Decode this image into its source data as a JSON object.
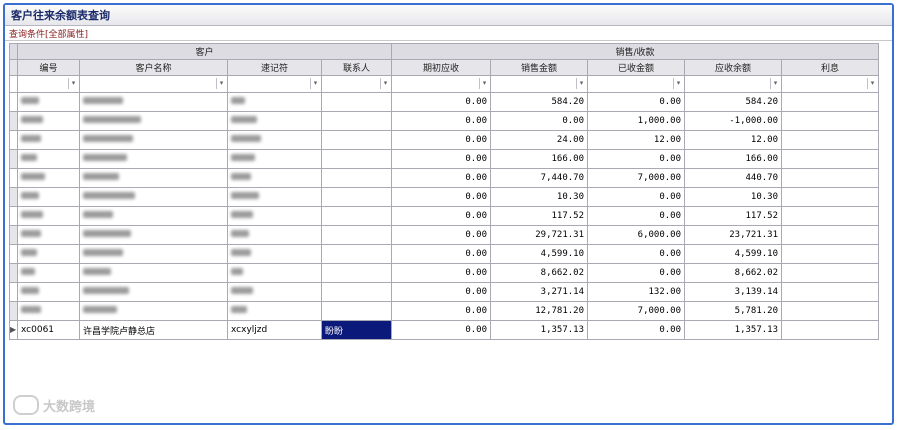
{
  "window": {
    "title": "客户往来余额表查询"
  },
  "conditions": {
    "label": "查询条件",
    "attr": "[全部属性]"
  },
  "groups": {
    "customer": "客户",
    "sales": "销售/收款"
  },
  "columns": {
    "code": "编号",
    "name": "客户名称",
    "mnemonic": "速记符",
    "contact": "联系人",
    "opening": "期初应收",
    "sales_amount": "销售金额",
    "received": "已收金额",
    "receivable": "应收余额",
    "interest": "利息"
  },
  "rows": [
    {
      "opening": "0.00",
      "sales_amount": "584.20",
      "received": "0.00",
      "receivable": "584.20"
    },
    {
      "opening": "0.00",
      "sales_amount": "0.00",
      "received": "1,000.00",
      "receivable": "-1,000.00"
    },
    {
      "opening": "0.00",
      "sales_amount": "24.00",
      "received": "12.00",
      "receivable": "12.00"
    },
    {
      "opening": "0.00",
      "sales_amount": "166.00",
      "received": "0.00",
      "receivable": "166.00"
    },
    {
      "opening": "0.00",
      "sales_amount": "7,440.70",
      "received": "7,000.00",
      "receivable": "440.70"
    },
    {
      "opening": "0.00",
      "sales_amount": "10.30",
      "received": "0.00",
      "receivable": "10.30"
    },
    {
      "opening": "0.00",
      "sales_amount": "117.52",
      "received": "0.00",
      "receivable": "117.52"
    },
    {
      "opening": "0.00",
      "sales_amount": "29,721.31",
      "received": "6,000.00",
      "receivable": "23,721.31"
    },
    {
      "opening": "0.00",
      "sales_amount": "4,599.10",
      "received": "0.00",
      "receivable": "4,599.10"
    },
    {
      "opening": "0.00",
      "sales_amount": "8,662.02",
      "received": "0.00",
      "receivable": "8,662.02"
    },
    {
      "opening": "0.00",
      "sales_amount": "3,271.14",
      "received": "132.00",
      "receivable": "3,139.14"
    },
    {
      "opening": "0.00",
      "sales_amount": "12,781.20",
      "received": "7,000.00",
      "receivable": "5,781.20"
    },
    {
      "code": "xc0061",
      "name": "许昌学院卢静总店",
      "mnemonic": "xcxyljzd",
      "contact": "盼盼",
      "opening": "0.00",
      "sales_amount": "1,357.13",
      "received": "0.00",
      "receivable": "1,357.13"
    }
  ],
  "watermark": {
    "text": "大数跨境"
  },
  "colors": {
    "frame": "#3a6fcf",
    "selection": "#0b1a7a",
    "header": "#e6e6ea"
  }
}
